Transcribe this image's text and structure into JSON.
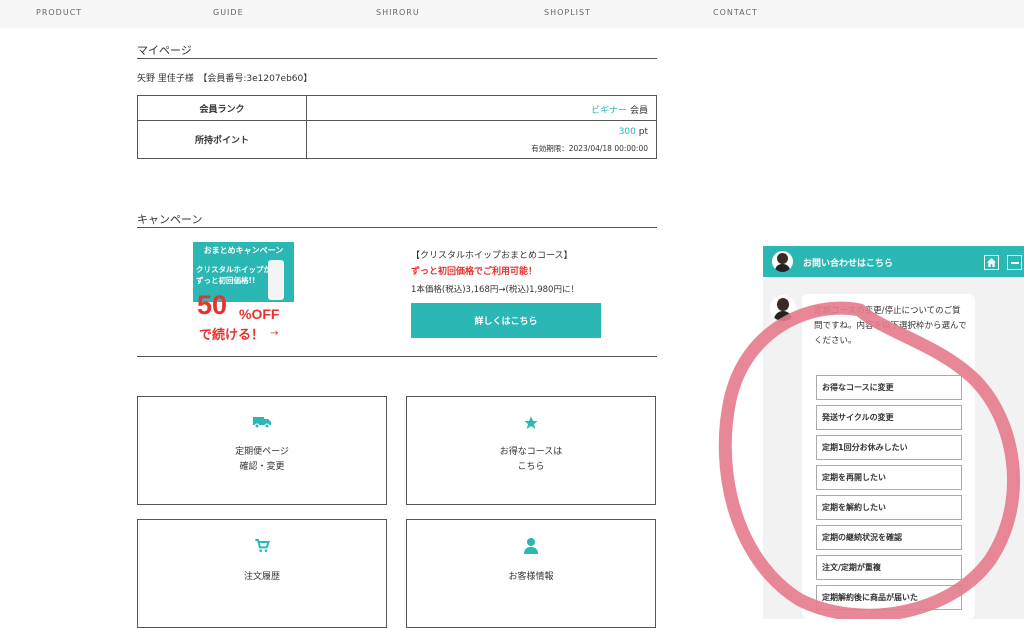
{
  "nav": [
    "PRODUCT",
    "GUIDE",
    "SHIRORU",
    "SHOPLIST",
    "CONTACT"
  ],
  "mypage": {
    "title": "マイページ",
    "member": "矢野 里佳子様　【会員番号:3e1207eb60】",
    "rank_label": "会員ランク",
    "rank_value": "ビギナー",
    "rank_suffix": " 会員",
    "points_label": "所持ポイント",
    "points_value": "300",
    "points_unit": " pt",
    "expiry": "有効期限：2023/04/18 00:00:00"
  },
  "campaign": {
    "title": "キャンペーン",
    "banner_top": "おまとめキャンペーン",
    "banner_line1": "クリスタルホイップが",
    "banner_line2": "ずっと初回価格!!",
    "banner_big": "50",
    "banner_off": "%OFF",
    "banner_continue": "で続ける！",
    "banner_arrow": "→",
    "course": "【クリスタルホイップおまとめコース】",
    "red_text": "ずっと初回価格でご利用可能！",
    "price": "1本価格(税込)3,168円→(税込)1,980円に！",
    "button": "詳しくはこちら"
  },
  "cards": [
    {
      "icon": "truck-icon",
      "line1": "定期便ページ",
      "line2": "確認・変更"
    },
    {
      "icon": "star-icon",
      "line1": "お得なコースは",
      "line2": "こちら"
    },
    {
      "icon": "cart-icon",
      "line1": "注文履歴",
      "line2": ""
    },
    {
      "icon": "user-icon",
      "line1": "お客様情報",
      "line2": ""
    }
  ],
  "chat": {
    "title": "お問い合わせはこちら",
    "message": "定期コースの変更/停止についてのご質問ですね。内容を以下選択枠から選んでください。",
    "options": [
      "お得なコースに変更",
      "発送サイクルの変更",
      "定期1回分お休みしたい",
      "定期を再開したい",
      "定期を解約したい",
      "定期の継続状況を確認",
      "注文/定期が重複",
      "定期解約後に商品が届いた"
    ]
  },
  "colors": {
    "accent": "#2bb7b3",
    "red": "#e8322f",
    "annotation": "#e57a8c"
  }
}
